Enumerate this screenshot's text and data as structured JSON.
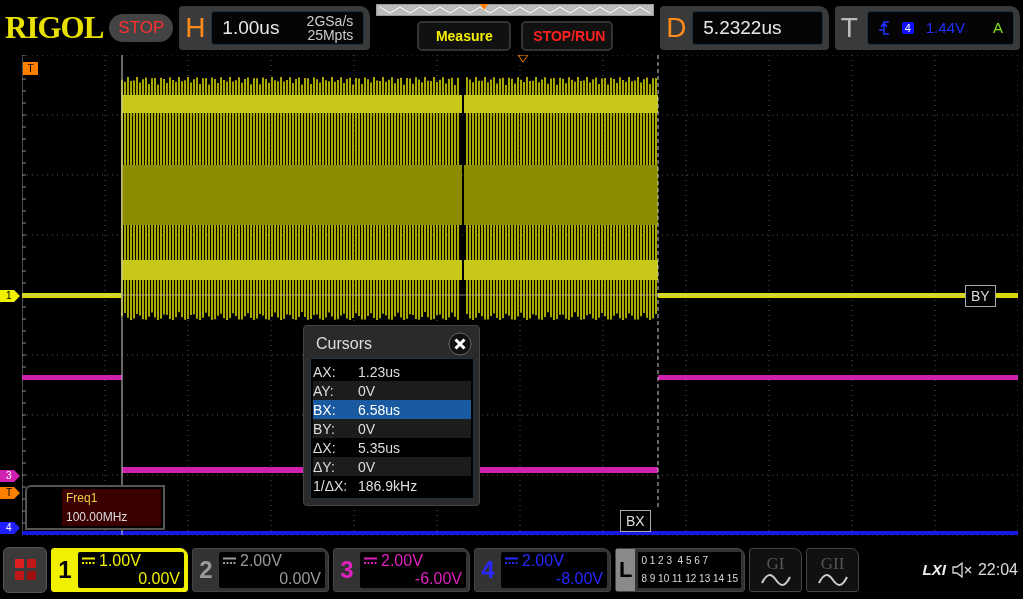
{
  "header": {
    "logo": "RIGOL",
    "run_state": "STOP",
    "horizontal": {
      "label": "H",
      "timebase": "1.00us",
      "sample_rate": "2GSa/s",
      "memory_depth": "25Mpts"
    },
    "buttons": [
      {
        "label": "Measure",
        "kind": "measure"
      },
      {
        "label": "STOP/RUN",
        "kind": "stoprun"
      }
    ],
    "delay": {
      "label": "D",
      "value": "5.2322us"
    },
    "trigger": {
      "label": "T",
      "source": "4",
      "level": "1.44V",
      "mode": "A"
    }
  },
  "plot": {
    "trigger_position": {
      "label": "T"
    },
    "channel_markers": [
      {
        "label": "1",
        "color": "#f0f000"
      },
      {
        "label": "3",
        "color": "#d020b0"
      },
      {
        "label": "T",
        "color": "#ff8000"
      },
      {
        "label": "4",
        "color": "#2020ff"
      }
    ],
    "cursor_labels": [
      {
        "label": "BY"
      },
      {
        "label": "BX"
      }
    ],
    "measurement": {
      "name": "Freq1",
      "value": "100.00MHz"
    },
    "cursors_dialog": {
      "title": "Cursors",
      "rows": [
        {
          "label": "AX:",
          "value": "1.23us",
          "selected": false
        },
        {
          "label": "AY:",
          "value": "0V",
          "selected": false
        },
        {
          "label": "BX:",
          "value": "6.58us",
          "selected": true
        },
        {
          "label": "BY:",
          "value": "0V",
          "selected": false
        },
        {
          "label": "ΔX:",
          "value": "5.35us",
          "selected": false
        },
        {
          "label": "ΔY:",
          "value": "0V",
          "selected": false
        },
        {
          "label": "1/ΔX:",
          "value": "186.9kHz",
          "selected": false
        }
      ]
    }
  },
  "channels": [
    {
      "number": "1",
      "scale": "1.00V",
      "offset": "0.00V",
      "color": "#f0f000",
      "selected": true
    },
    {
      "number": "2",
      "scale": "2.00V",
      "offset": "0.00V",
      "color": "#9a9a9a",
      "selected": false
    },
    {
      "number": "3",
      "scale": "2.00V",
      "offset": "-6.00V",
      "color": "#e020c0",
      "selected": false
    },
    {
      "number": "4",
      "scale": "2.00V",
      "offset": "-8.00V",
      "color": "#2828ff",
      "selected": false
    }
  ],
  "logic": {
    "label": "L",
    "bit_rows": [
      "0 1 2 3  4 5 6 7",
      "8 9 10 11 12 13 14 15"
    ]
  },
  "generators": [
    {
      "label": "GI"
    },
    {
      "label": "GII"
    }
  ],
  "status": {
    "lxi": "LXI",
    "time": "22:04"
  }
}
